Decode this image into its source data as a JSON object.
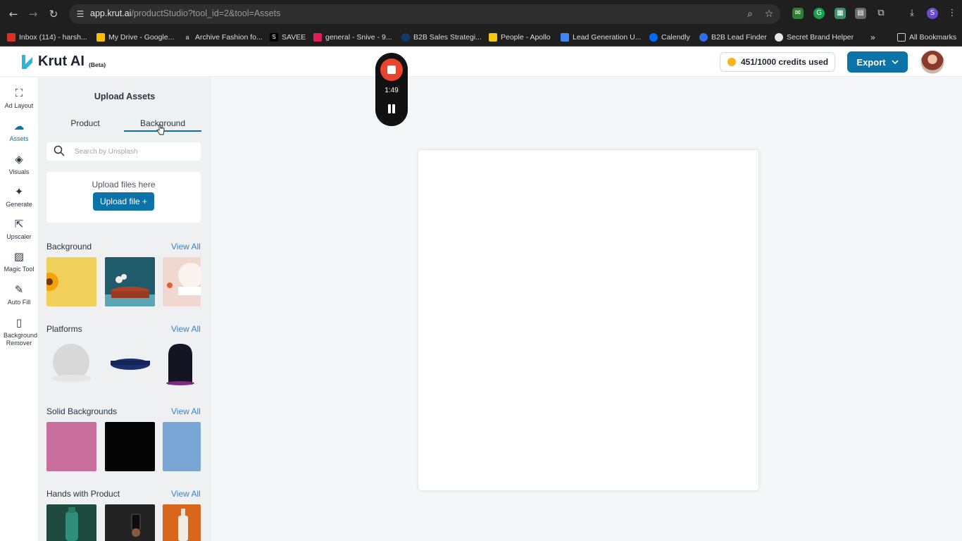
{
  "browser": {
    "url_host": "app.krut.ai",
    "url_path": "/productStudio?tool_id=2&tool=Assets",
    "bookmarks": [
      {
        "label": "Inbox (114) - harsh...",
        "color": "#d93025"
      },
      {
        "label": "My Drive - Google...",
        "color": "#fbbc04"
      },
      {
        "label": "Archive Fashion fo...",
        "color": "#1f1f1f"
      },
      {
        "label": "SAVEE",
        "color": "#000000"
      },
      {
        "label": "general - Snive - 9...",
        "color": "#e01e5a"
      },
      {
        "label": "B2B Sales Strategi...",
        "color": "#123a6b"
      },
      {
        "label": "People - Apollo",
        "color": "#f5c518"
      },
      {
        "label": "Lead Generation U...",
        "color": "#4285f4"
      },
      {
        "label": "Calendly",
        "color": "#006bff"
      },
      {
        "label": "B2B Lead Finder",
        "color": "#2f6fed"
      },
      {
        "label": "Secret Brand Helper",
        "color": "#e6e6e6"
      }
    ],
    "all_bookmarks": "All Bookmarks"
  },
  "app": {
    "logo_text": "Krut AI",
    "beta": "(Beta)",
    "credits": "451/1000 credits used",
    "export": "Export"
  },
  "recorder": {
    "time": "1:49"
  },
  "rail": [
    {
      "label": "Ad Layout",
      "icon": "expand-icon",
      "glyph": "⛶"
    },
    {
      "label": "Assets",
      "icon": "cloud-upload-icon",
      "glyph": "☁"
    },
    {
      "label": "Visuals",
      "icon": "shapes-icon",
      "glyph": "◈"
    },
    {
      "label": "Generate",
      "icon": "magic-wand-icon",
      "glyph": "✦"
    },
    {
      "label": "Upscaler",
      "icon": "external-link-icon",
      "glyph": "⇱"
    },
    {
      "label": "Magic Tool",
      "icon": "stripes-icon",
      "glyph": "▨"
    },
    {
      "label": "Auto Fill",
      "icon": "brush-icon",
      "glyph": "✎"
    },
    {
      "label": "Background Remover",
      "icon": "document-icon",
      "glyph": "▯"
    }
  ],
  "panel": {
    "title": "Upload Assets",
    "tabs": [
      "Product",
      "Background"
    ],
    "active_tab": "Background",
    "search_placeholder": "Search by Unsplash",
    "upload_text": "Upload files here",
    "upload_button": "Upload file +",
    "view_all": "View All",
    "sections": [
      "Background",
      "Platforms",
      "Solid Backgrounds",
      "Hands with Product"
    ]
  },
  "colors": {
    "accent": "#0b73a8",
    "link": "#3b82c4",
    "recorder_stop": "#e8452f",
    "solid_backgrounds": [
      "#c96f9e",
      "#050505",
      "#7aa6d6"
    ]
  }
}
